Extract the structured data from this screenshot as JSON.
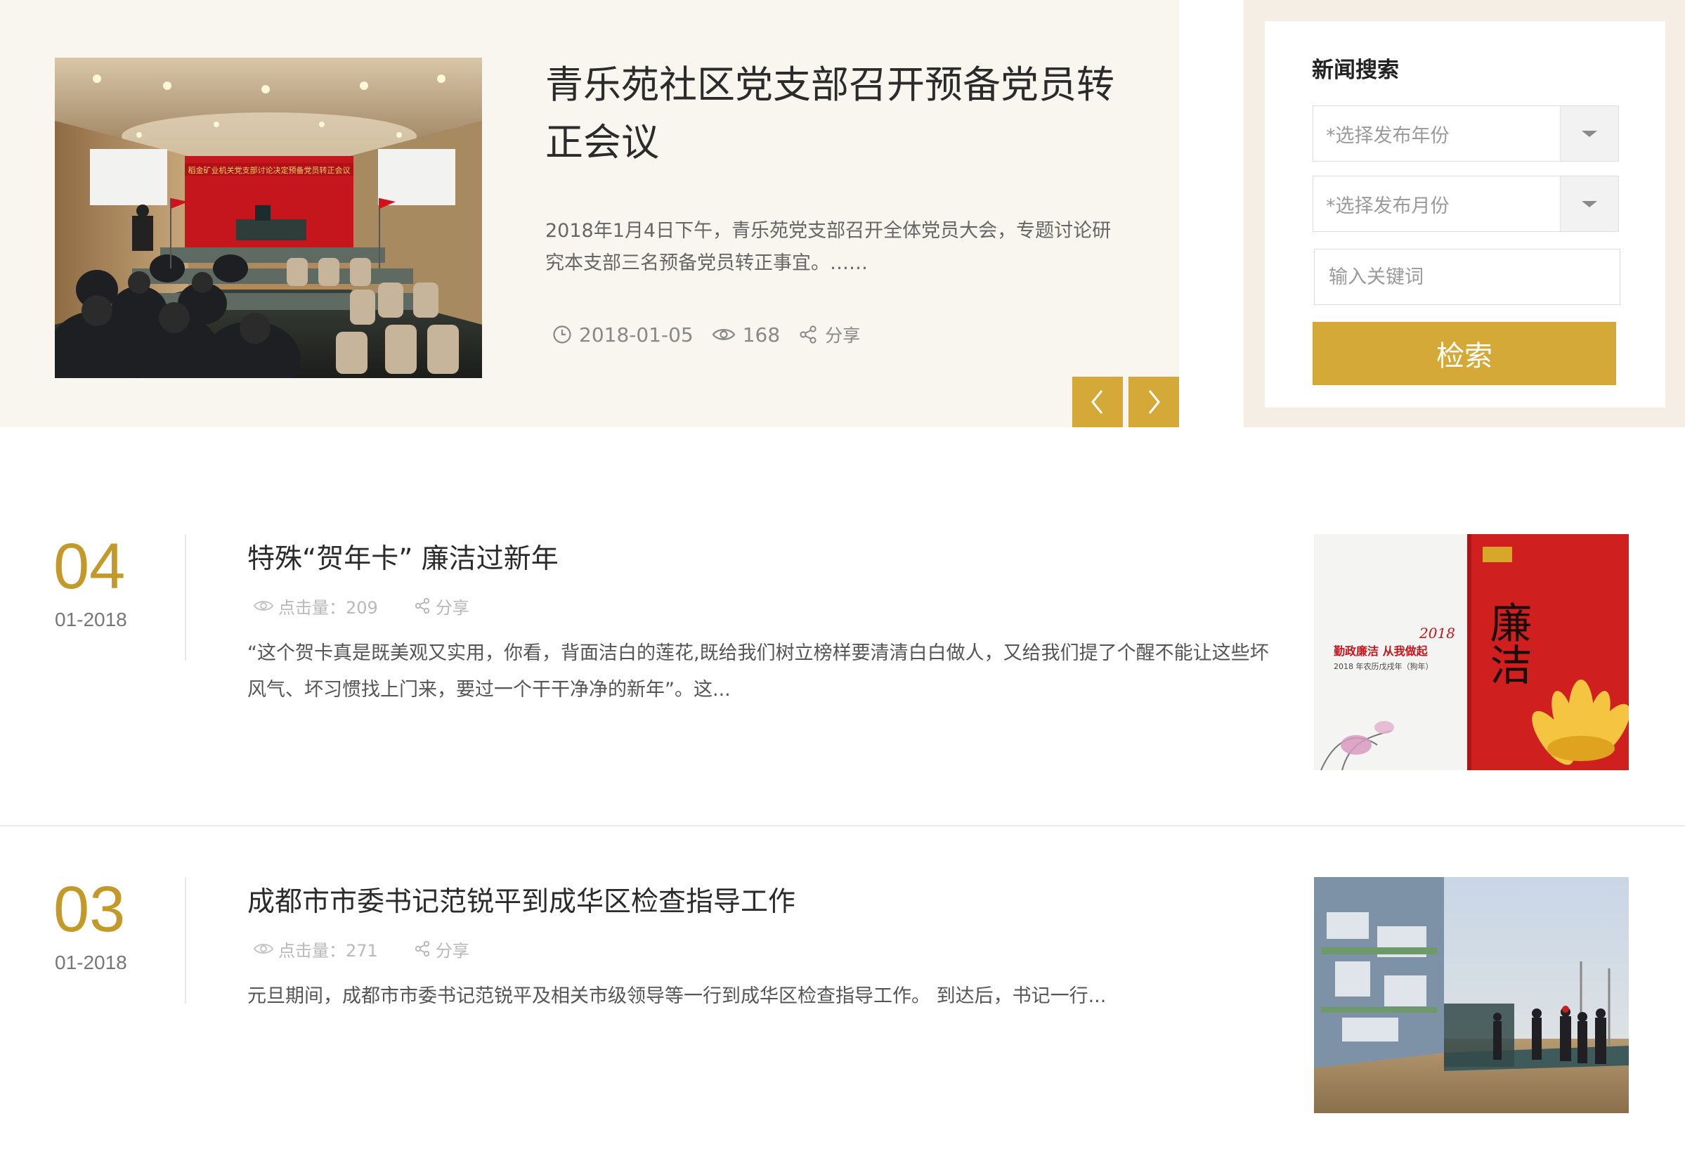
{
  "featured": {
    "title": "青乐苑社区党支部召开预备党员转正会议",
    "image_banner_text": "稻金矿业机关党支部讨论决定预备党员转正会议",
    "summary": "2018年1月4日下午，青乐苑党支部召开全体党员大会，专题讨论研究本支部三名预备党员转正事宜。……",
    "date": "2018-01-05",
    "views": "168",
    "share_label": "分享",
    "prev_icon": "chevron-left-icon",
    "next_icon": "chevron-right-icon"
  },
  "search": {
    "title": "新闻搜索",
    "year_placeholder": "*选择发布年份",
    "month_placeholder": "*选择发布月份",
    "keyword_placeholder": "输入关键词",
    "button_label": "检索"
  },
  "news": [
    {
      "day": "04",
      "month_year": "01-2018",
      "title": "特殊“贺年卡” 廉洁过新年",
      "clicks_label": "点击量：209",
      "share_label": "分享",
      "summary": "“这个贺卡真是既美观又实用，你看，背面洁白的莲花,既给我们树立榜样要清清白白做人，又给我们提了个醒不能让这些坏风气、坏习惯找上门来，要过一个干干净净的新年”。这...",
      "card_title_line1": "勤政廉洁 从我做起",
      "card_title_line2": "2018 年农历戊戌年（狗年）",
      "card_big_text": "廉洁",
      "card_year": "2018"
    },
    {
      "day": "03",
      "month_year": "01-2018",
      "title": "成都市市委书记范锐平到成华区检查指导工作",
      "clicks_label": "点击量：271",
      "share_label": "分享",
      "summary": "元旦期间，成都市市委书记范锐平及相关市级领导等一行到成华区检查指导工作。 到达后，书记一行..."
    }
  ],
  "colors": {
    "accent": "#d4a937",
    "date_gold": "#c39a2a",
    "featured_bg": "#f9f6f0",
    "search_bg": "#f4eee5"
  }
}
